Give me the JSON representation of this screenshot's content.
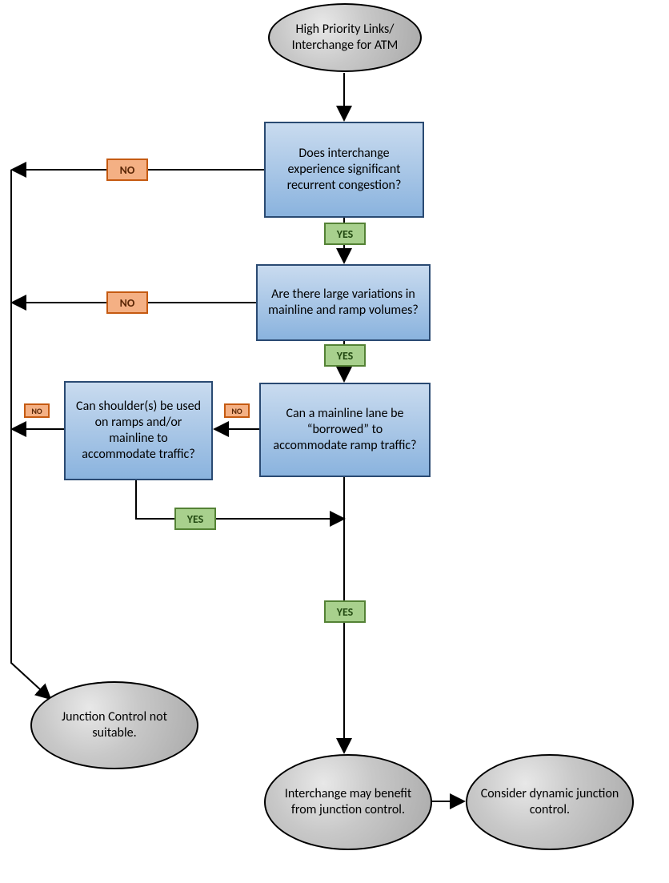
{
  "nodes": {
    "start": "High Priority Links/ Interchange for ATM",
    "q1": "Does interchange experience significant recurrent congestion?",
    "q2": "Are there large variations in mainline and ramp volumes?",
    "q3": "Can a mainline lane be “borrowed” to accommodate ramp traffic?",
    "q4": "Can shoulder(s) be used on ramps and/or mainline to accommodate traffic?",
    "end_no": "Junction Control not suitable.",
    "end_yes": "Interchange may benefit from junction control.",
    "end_next": "Consider dynamic junction control."
  },
  "labels": {
    "yes": "YES",
    "no": "NO"
  }
}
